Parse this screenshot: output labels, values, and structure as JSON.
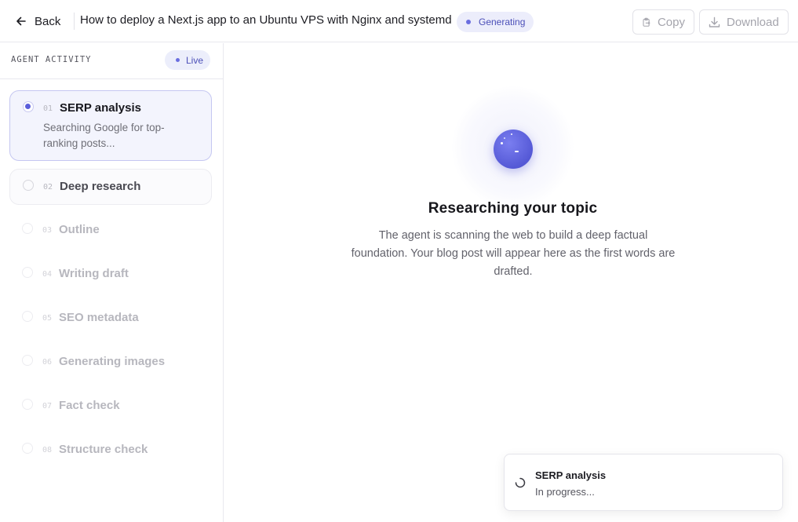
{
  "header": {
    "back_label": "Back",
    "title": "How to deploy a Next.js app to an Ubuntu VPS with Nginx and systemd",
    "status_badge": "Generating",
    "copy_label": "Copy",
    "download_label": "Download"
  },
  "sidebar": {
    "heading": "AGENT ACTIVITY",
    "live_badge": "Live",
    "steps": [
      {
        "num": "01",
        "title": "SERP analysis",
        "desc": "Searching Google for top-ranking posts...",
        "state": "active"
      },
      {
        "num": "02",
        "title": "Deep research",
        "state": "next"
      },
      {
        "num": "03",
        "title": "Outline",
        "state": "pending"
      },
      {
        "num": "04",
        "title": "Writing draft",
        "state": "pending"
      },
      {
        "num": "05",
        "title": "SEO metadata",
        "state": "pending"
      },
      {
        "num": "06",
        "title": "Generating images",
        "state": "pending"
      },
      {
        "num": "07",
        "title": "Fact check",
        "state": "pending"
      },
      {
        "num": "08",
        "title": "Structure check",
        "state": "pending"
      }
    ]
  },
  "main": {
    "title": "Researching your topic",
    "description": "The agent is scanning the web to build a deep factual foundation. Your blog post will appear here as the first words are drafted."
  },
  "toast": {
    "title": "SERP analysis",
    "subtitle": "In progress..."
  },
  "colors": {
    "accent": "#5a5edb",
    "accent_soft": "#ecedfb",
    "border": "#e8e8ee"
  }
}
